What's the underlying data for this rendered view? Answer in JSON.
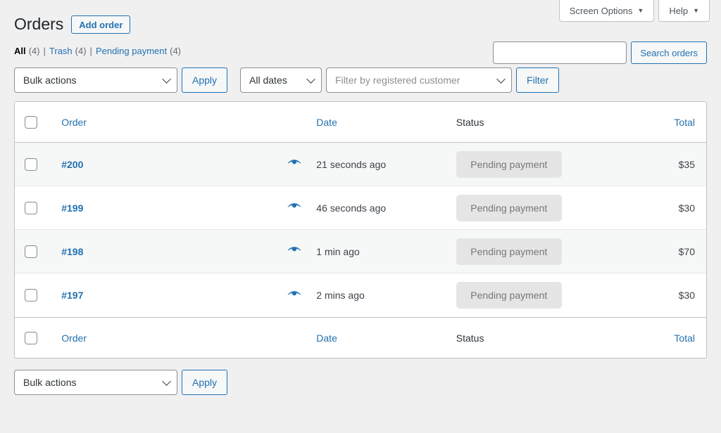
{
  "screen_meta": {
    "screen_options_label": "Screen Options",
    "help_label": "Help",
    "caret": "▼"
  },
  "header": {
    "page_title": "Orders",
    "add_order_label": "Add order"
  },
  "search": {
    "value": "",
    "placeholder": "",
    "button_label": "Search orders"
  },
  "status_links": [
    {
      "label": "All",
      "count": "(4)",
      "current": true
    },
    {
      "label": "Trash",
      "count": "(4)",
      "current": false
    },
    {
      "label": "Pending payment",
      "count": "(4)",
      "current": false
    }
  ],
  "separator": "|",
  "tablenav_top": {
    "bulk_actions_value": "Bulk actions",
    "apply_label": "Apply",
    "dates_value": "All dates",
    "customer_placeholder": "Filter by registered customer",
    "filter_label": "Filter"
  },
  "tablenav_bottom": {
    "bulk_actions_value": "Bulk actions",
    "apply_label": "Apply"
  },
  "table": {
    "columns": {
      "order": "Order",
      "date": "Date",
      "status": "Status",
      "total": "Total"
    },
    "rows": [
      {
        "order": "#200",
        "date": "21 seconds ago",
        "status": "Pending payment",
        "total": "$35"
      },
      {
        "order": "#199",
        "date": "46 seconds ago",
        "status": "Pending payment",
        "total": "$30"
      },
      {
        "order": "#198",
        "date": "1 min ago",
        "status": "Pending payment",
        "total": "$70"
      },
      {
        "order": "#197",
        "date": "2 mins ago",
        "status": "Pending payment",
        "total": "$30"
      }
    ]
  },
  "icons": {
    "preview": "eye-icon",
    "chevron": "chevron-down-icon"
  },
  "colors": {
    "page_background": "#f0f0f1",
    "link_blue": "#2271b1",
    "badge_background": "#e5e5e5",
    "badge_text": "#777777",
    "row_alt_background": "#f6f7f7",
    "border": "#c3c4c7"
  }
}
